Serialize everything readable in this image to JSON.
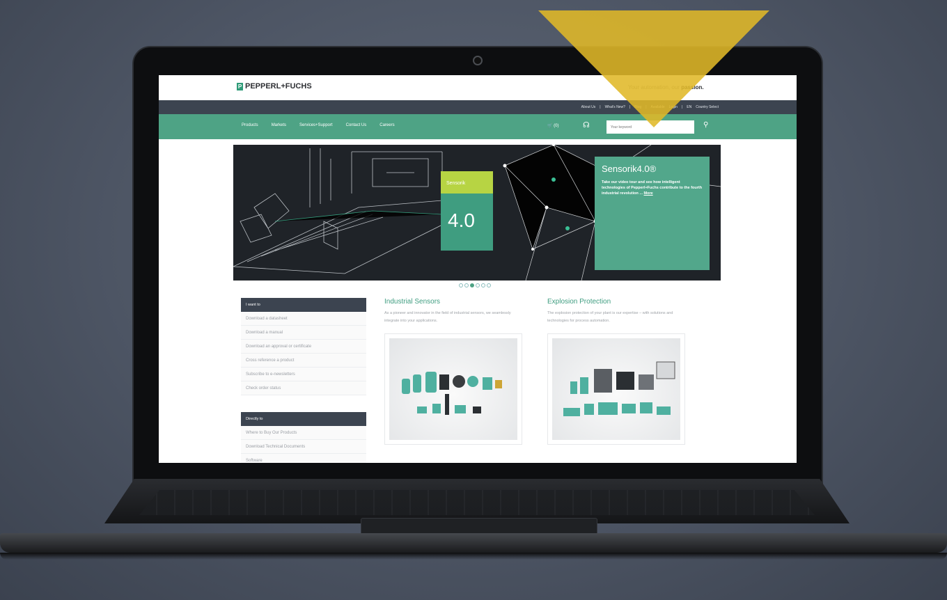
{
  "site": {
    "logo_text": "PEPPERL+FUCHS",
    "logo_mark": "P",
    "tagline_normal": "Your automation, our ",
    "tagline_bold": "passion."
  },
  "utility_links": [
    "About Us",
    "|",
    "What's New?",
    "|",
    "Blog",
    "|",
    "Available",
    "Login",
    "|",
    "EN",
    "Country Select"
  ],
  "nav": {
    "items": [
      "Products",
      "Markets",
      "Services+Support",
      "Contact Us",
      "Careers"
    ],
    "cart": "(0)"
  },
  "search": {
    "placeholder": "Your keyword"
  },
  "hero": {
    "badge": "Sensorik",
    "badge_number": "4.0",
    "title": "Sensorik4.0®",
    "text": "Take our video tour and see how intelligent technologies of Pepperl+Fuchs contribute to the fourth industrial revolution ... ",
    "more": "More"
  },
  "carousel": {
    "count": 6,
    "active": 2
  },
  "sidebar": {
    "section1_title": "I want to",
    "section1_items": [
      "Download a datasheet",
      "Download a manual",
      "Download an approval or certificate",
      "Cross reference a product",
      "Subscribe to e-newsletters",
      "Check order status"
    ],
    "section2_title": "Directly to",
    "section2_items": [
      "Where to Buy Our Products",
      "Download Technical Documents",
      "Software"
    ]
  },
  "columns": [
    {
      "title": "Industrial Sensors",
      "text": "As a pioneer and innovator in the field of industrial sensors, we seamlessly integrate into your applications."
    },
    {
      "title": "Explosion Protection",
      "text": "The explosion protection of your plant is our expertise – with solutions and technologies for process automation."
    }
  ],
  "colors": {
    "brand_green": "#4ea385",
    "dark_bar": "#3c4450",
    "accent_yellow": "#e0b828"
  }
}
